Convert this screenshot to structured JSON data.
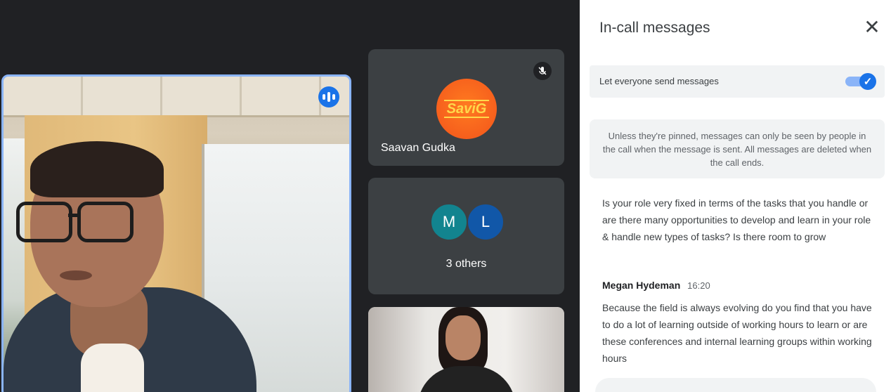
{
  "participants": {
    "saavan": {
      "name": "Saavan Gudka",
      "avatar_text": "SaviG"
    },
    "others": {
      "avatars": [
        "M",
        "L"
      ],
      "label": "3 others"
    }
  },
  "panel": {
    "title": "In-call messages",
    "toggle": {
      "label": "Let everyone send messages",
      "on": true
    },
    "notice": "Unless they're pinned, messages can only be seen by people in the call when the message is sent. All messages are deleted when the call ends.",
    "messages": [
      {
        "sender": "",
        "time": "",
        "text": "Is your role very fixed in terms of the tasks that you handle or are there many opportunities to develop and learn in your role & handle new types of tasks? Is there room to grow"
      },
      {
        "sender": "Megan Hydeman",
        "time": "16:20",
        "text": "Because the field is always evolving do you find that you have to do a lot of learning outside of working hours to learn or are these conferences and internal learning groups within working hours"
      }
    ]
  },
  "icons": {
    "close": "close-icon",
    "mic_off": "mic-off-icon",
    "speaking": "speaking-icon",
    "check": "check-icon"
  },
  "colors": {
    "accent": "#1a73e8",
    "stage_bg": "#202124",
    "tile_bg": "#3c4043"
  }
}
